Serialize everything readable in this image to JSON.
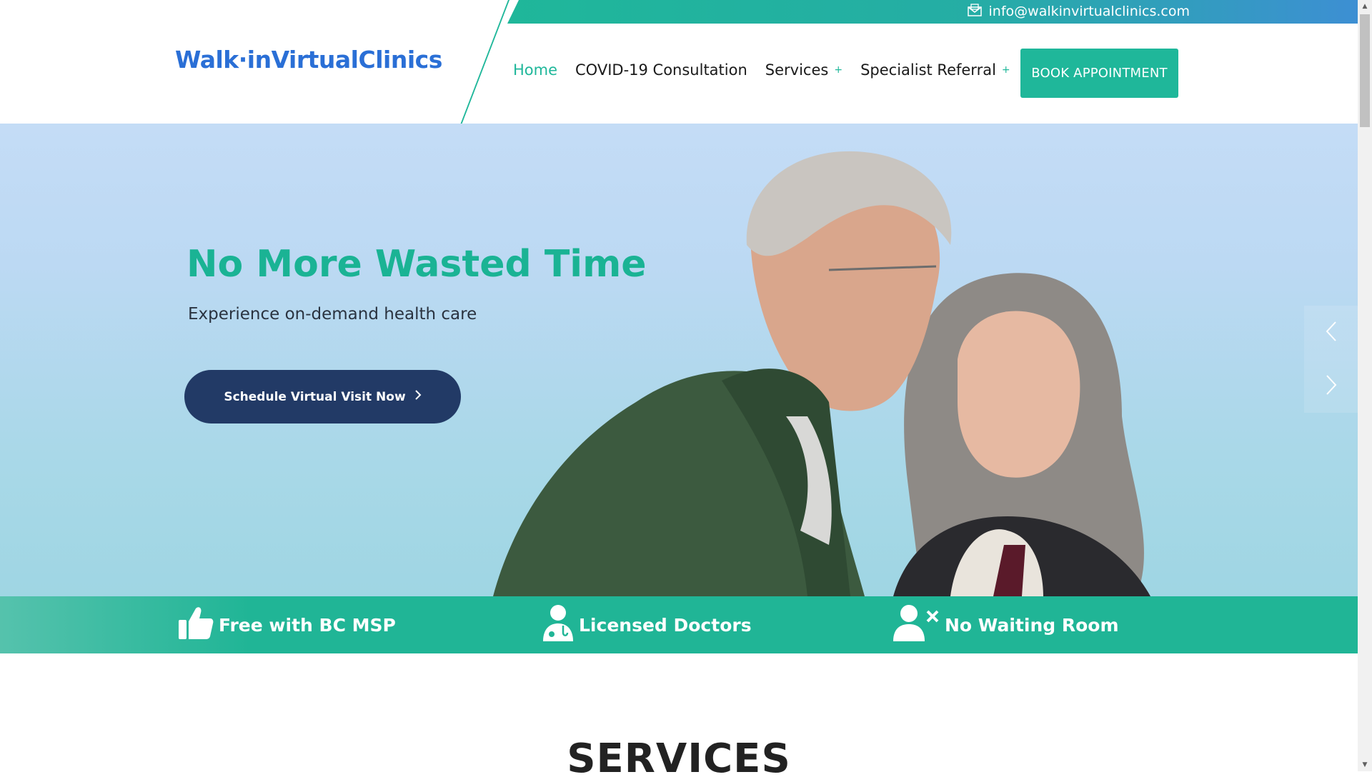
{
  "topbar": {
    "email": "info@walkinvirtualclinics.com",
    "icon": "envelope-icon"
  },
  "brand": {
    "logo_text": "Walk·inVirtualClinics"
  },
  "nav": {
    "items": [
      {
        "label": "Home",
        "active": true,
        "has_submenu": false
      },
      {
        "label": "COVID-19 Consultation",
        "active": false,
        "has_submenu": false
      },
      {
        "label": "Services",
        "active": false,
        "has_submenu": true
      },
      {
        "label": "Specialist Referral",
        "active": false,
        "has_submenu": true
      }
    ],
    "submenu_glyph": "+",
    "book_label": "BOOK APPOINTMENT"
  },
  "hero": {
    "title": "No More Wasted Time",
    "subtitle": "Experience on-demand health care",
    "cta_label": "Schedule Virtual Visit Now",
    "cta_icon": "chevron-right-icon",
    "prev_icon": "chevron-left-icon",
    "next_icon": "chevron-right-icon"
  },
  "features": [
    {
      "label": "Free with BC MSP",
      "icon": "thumbs-up-icon"
    },
    {
      "label": "Licensed Doctors",
      "icon": "doctor-icon"
    },
    {
      "label": "No Waiting Room",
      "icon": "user-remove-icon"
    }
  ],
  "services": {
    "title": "SERVICES"
  },
  "colors": {
    "accent": "#1fb79a",
    "brand_blue": "#2a6fd6",
    "navy": "#223a66",
    "hero_bg": "#b5dbee"
  }
}
